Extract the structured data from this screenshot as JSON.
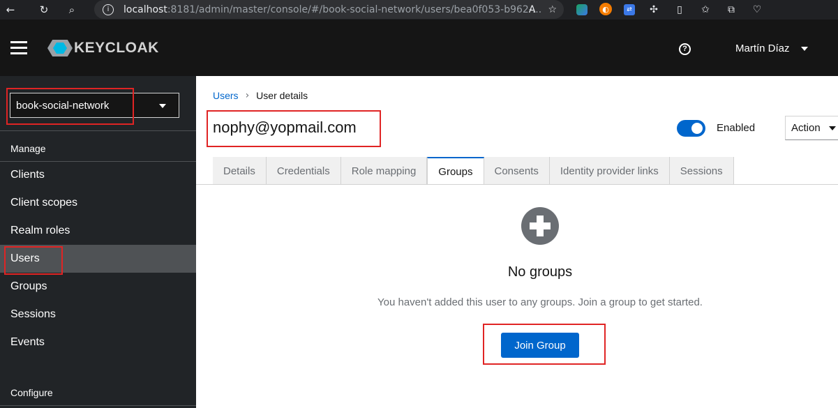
{
  "browser": {
    "url_host": "localhost",
    "url_path": ":8181/admin/master/console/#/book-social-network/users/bea0f053-b962-...",
    "icons": [
      "back-icon",
      "reload-icon",
      "search-icon",
      "info-icon",
      "read-aloud-icon",
      "favorite-icon",
      "extension-icon",
      "split-screen-icon",
      "favorites-icon",
      "collections-icon",
      "health-icon"
    ]
  },
  "header": {
    "logo_text": "KEYCLOAK",
    "user_name": "Martín Díaz"
  },
  "sidebar": {
    "realm": "book-social-network",
    "manage_label": "Manage",
    "items": [
      {
        "label": "Clients"
      },
      {
        "label": "Client scopes"
      },
      {
        "label": "Realm roles"
      },
      {
        "label": "Users"
      },
      {
        "label": "Groups"
      },
      {
        "label": "Sessions"
      },
      {
        "label": "Events"
      }
    ],
    "configure_label": "Configure"
  },
  "main": {
    "breadcrumb": {
      "parent": "Users",
      "current": "User details"
    },
    "title": "nophy@yopmail.com",
    "enabled_label": "Enabled",
    "action_label": "Action",
    "tabs": [
      {
        "label": "Details"
      },
      {
        "label": "Credentials"
      },
      {
        "label": "Role mapping"
      },
      {
        "label": "Groups"
      },
      {
        "label": "Consents"
      },
      {
        "label": "Identity provider links"
      },
      {
        "label": "Sessions"
      }
    ],
    "empty_title": "No groups",
    "empty_body": "You haven't added this user to any groups. Join a group to get started.",
    "join_button": "Join Group"
  },
  "colors": {
    "accent": "#0066cc",
    "highlight_box": "#e02424"
  }
}
